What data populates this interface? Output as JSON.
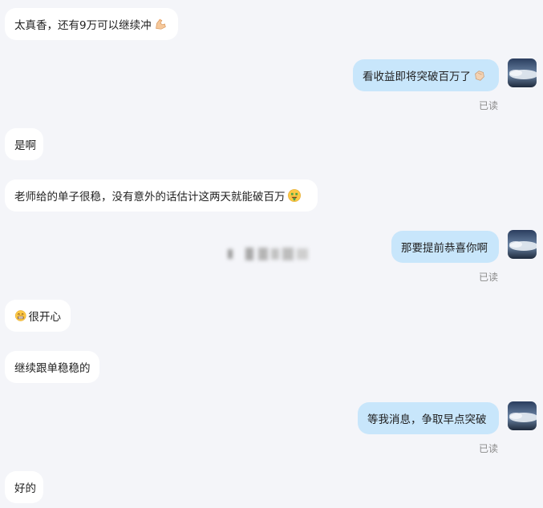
{
  "messages": [
    {
      "side": "in",
      "text": "太真香，还有9万可以继续冲",
      "emoji": "flexed-biceps-icon"
    },
    {
      "side": "out",
      "text": "看收益即将突破百万了",
      "emoji": "clapping-hands-icon",
      "read": "已读"
    },
    {
      "side": "in",
      "text": "是啊"
    },
    {
      "side": "in",
      "text": "老师给的单子很稳，没有意外的话估计这两天就能破百万",
      "emoji": "money-face-icon"
    },
    {
      "side": "out",
      "text": "那要提前恭喜你啊",
      "read": "已读"
    },
    {
      "side": "in",
      "text": "很开心",
      "emoji": "grinning-face-icon"
    },
    {
      "side": "in",
      "text": "继续跟单稳稳的"
    },
    {
      "side": "out",
      "text": "等我消息，争取早点突破",
      "read": "已读"
    },
    {
      "side": "in",
      "text": "好的"
    }
  ],
  "colors": {
    "background": "#f4f5f9",
    "incoming_bubble": "#ffffff",
    "outgoing_bubble": "#c8e6fb",
    "read_receipt": "#8a8a8a"
  }
}
